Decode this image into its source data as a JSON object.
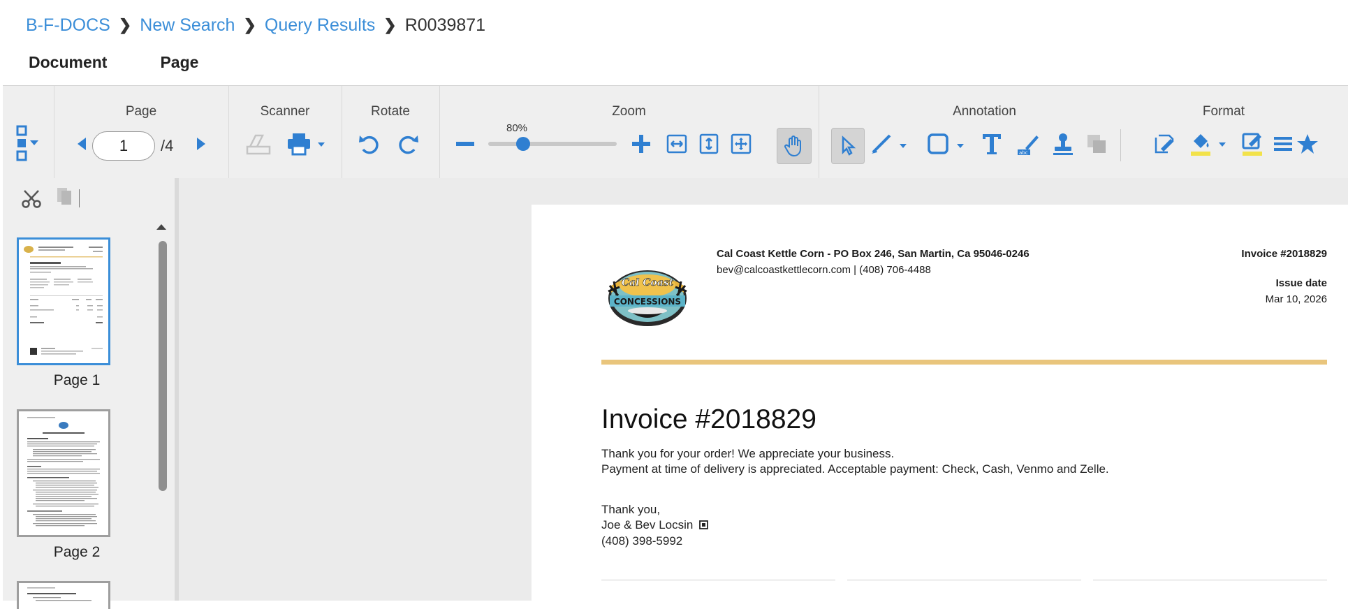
{
  "breadcrumb": {
    "items": [
      "B-F-DOCS",
      "New Search",
      "Query Results"
    ],
    "current": "R0039871"
  },
  "menu": {
    "document": "Document",
    "page": "Page"
  },
  "ribbon": {
    "groups": {
      "page": "Page",
      "scanner": "Scanner",
      "rotate": "Rotate",
      "zoom": "Zoom",
      "annotation": "Annotation",
      "format": "Format"
    },
    "page_current": "1",
    "page_total": "/4",
    "zoom_label": "80%",
    "zoom_fraction": 0.27
  },
  "thumbnails": [
    {
      "label": "Page 1",
      "selected": true
    },
    {
      "label": "Page 2",
      "selected": false
    }
  ],
  "document": {
    "company_line": "Cal Coast Kettle Corn - PO Box 246,  San Martin, Ca 95046-0246",
    "contact_line": "bev@calcoastkettlecorn.com | (408) 706-4488",
    "invoice_number_top": "Invoice #2018829",
    "issue_date_label": "Issue date",
    "issue_date": "Mar 10, 2026",
    "heading": "Invoice #2018829",
    "thanks_line": "Thank you for your order! We appreciate your business.",
    "payment_line": "Payment at time of delivery is appreciated. Acceptable payment: Check, Cash, Venmo and Zelle.",
    "signoff": "Thank you,",
    "names": "Joe & Bev Locsin",
    "phone": "(408) 398-5992",
    "logo_text_top": "Cal Coast",
    "logo_text_band": "CONCESSIONS"
  },
  "colors": {
    "link": "#3b8ed8",
    "accent_rule": "#e9c57c",
    "toolbar_icon": "#2f7fd1"
  }
}
